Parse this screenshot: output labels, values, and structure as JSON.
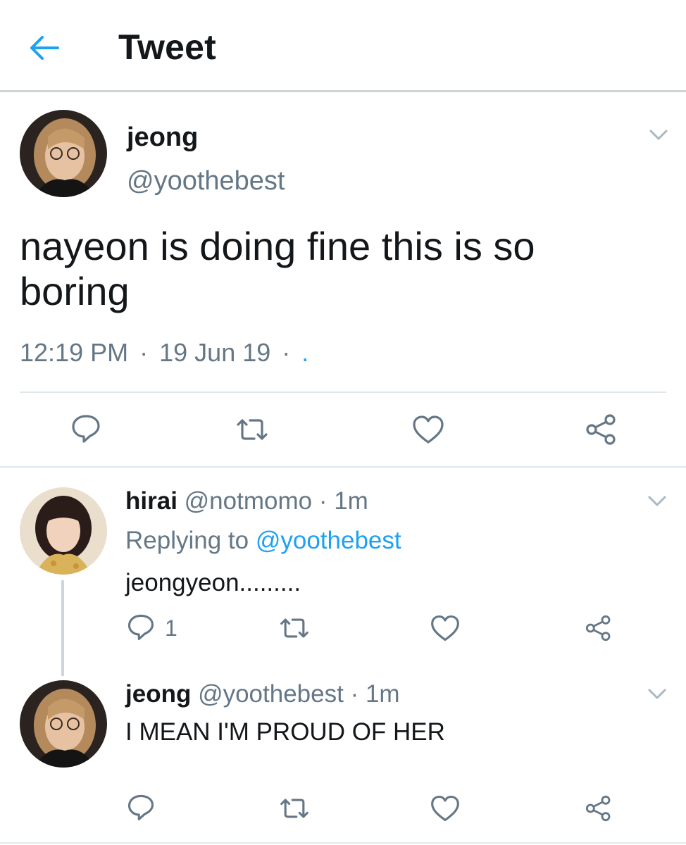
{
  "header": {
    "title": "Tweet"
  },
  "main_tweet": {
    "display_name": "jeong",
    "handle": "@yoothebest",
    "text": "nayeon is doing fine this is so boring",
    "time": "12:19 PM",
    "date": "19 Jun 19",
    "sep": "·",
    "trailing": "."
  },
  "replies": [
    {
      "display_name": "hirai",
      "handle": "@notmomo",
      "sep": "·",
      "age": "1m",
      "replying_prefix": "Replying to",
      "replying_handle": "@yoothebest",
      "text": "jeongyeon.........",
      "reply_count": "1"
    },
    {
      "display_name": "jeong",
      "handle": "@yoothebest",
      "sep": "·",
      "age": "1m",
      "text": "I MEAN I'M PROUD OF HER"
    }
  ],
  "icons": {
    "back": "arrow-left-icon",
    "reply": "speech-bubble-icon",
    "retweet": "retweet-arrows-icon",
    "like": "heart-outline-icon",
    "share": "share-nodes-icon",
    "more": "chevron-down-icon"
  },
  "colors": {
    "accent": "#1da1f2",
    "secondary_text": "#657786",
    "divider": "#e1e8ed",
    "thread_line": "#ccd6dd"
  }
}
